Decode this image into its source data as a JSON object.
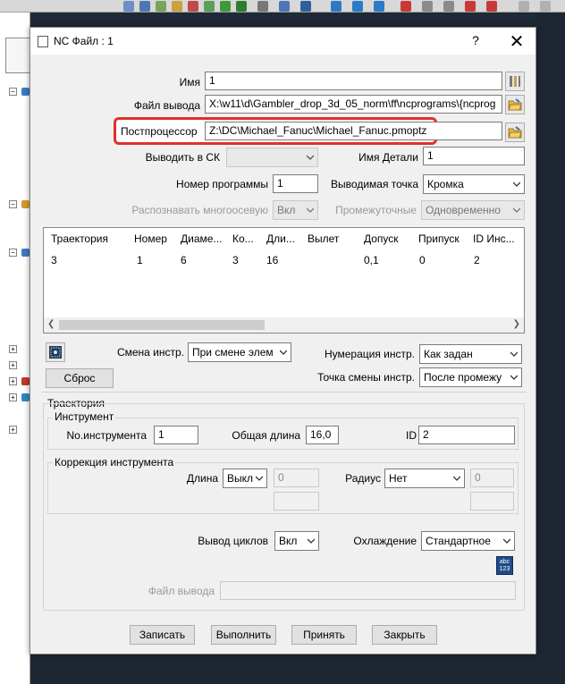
{
  "dialog": {
    "title": "NC Файл : 1",
    "help_glyph": "?",
    "close_glyph": "✕"
  },
  "fields": {
    "name_label": "Имя",
    "name_value": "1",
    "output_file_label": "Файл вывода",
    "output_file_value": "X:\\w11\\d\\Gambler_drop_3d_05_norm\\ff\\ncprograms\\{ncprog",
    "postprocessor_label": "Постпроцессор",
    "postprocessor_value": "Z:\\DC\\Michael_Fanuc\\Michael_Fanuc.pmoptz",
    "output_cs_label": "Выводить в СК",
    "output_cs_value": "",
    "part_name_label": "Имя Детали",
    "part_name_value": "1",
    "program_number_label": "Номер программы",
    "program_number_value": "1",
    "output_point_label": "Выводимая точка",
    "output_point_value": "Кромка",
    "multiaxis_label": "Распознавать многоосевую",
    "multiaxis_value": "Вкл",
    "intermediate_label": "Промежуточные",
    "intermediate_value": "Одновременно"
  },
  "table": {
    "columns": [
      "Траектория",
      "Номер",
      "Диаме...",
      "Ко...",
      "Дли...",
      "Вылет",
      "Допуск",
      "Припуск",
      "ID Инс..."
    ],
    "rows": [
      [
        "3",
        "1",
        "6",
        "3",
        "16",
        "",
        "0,1",
        "0",
        "2"
      ]
    ]
  },
  "tool_change": {
    "reset_button": "Сброс",
    "change_label": "Смена инстр.",
    "change_value": "При смене элем",
    "numbering_label": "Нумерация инстр.",
    "numbering_value": "Как задан",
    "change_point_label": "Точка смены инстр.",
    "change_point_value": "После промежу"
  },
  "toolpath": {
    "group_title": "Траектория",
    "tool_group_title": "Инструмент",
    "tool_number_label": "No.инструмента",
    "tool_number_value": "1",
    "total_length_label": "Общая длина",
    "total_length_value": "16,0",
    "id_label": "ID",
    "id_value": "2",
    "correction_group_title": "Коррекция инструмента",
    "length_label": "Длина",
    "length_value": "Выкл",
    "length_num": "0",
    "radius_label": "Радиус",
    "radius_value": "Нет",
    "radius_num": "0",
    "cycles_label": "Вывод циклов",
    "cycles_value": "Вкл",
    "coolant_label": "Охлаждение",
    "coolant_value": "Стандартное",
    "abc_icon_text": "abc\n123",
    "output_file_label": "Файл вывода",
    "output_file_value": ""
  },
  "buttons": {
    "write": "Записать",
    "execute": "Выполнить",
    "accept": "Принять",
    "close": "Закрыть"
  },
  "colors": {
    "highlight": "#e0312b",
    "dialog_bg": "#f0f0f0",
    "desktop_bg": "#1c2733"
  }
}
